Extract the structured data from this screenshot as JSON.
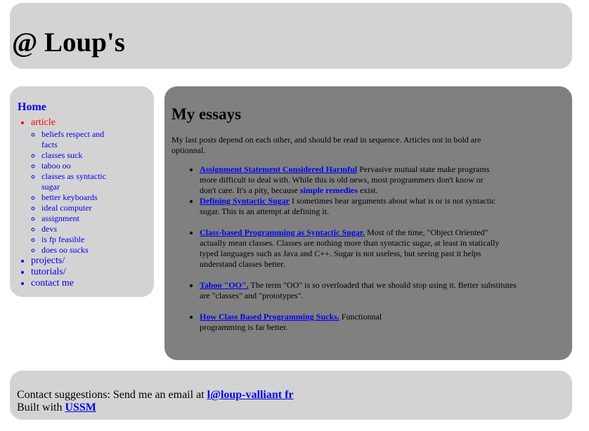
{
  "header": {
    "title": "@ Loup's"
  },
  "nav": {
    "home": "Home",
    "items": [
      {
        "label": "article",
        "current": true,
        "children": [
          "beliefs respect and facts",
          "classes suck",
          "taboo oo",
          "classes as syntactic sugar",
          "better keyboards",
          "ideal computer",
          "assignment",
          "devs",
          "is fp feasible",
          "does oo sucks"
        ]
      },
      {
        "label": "projects/"
      },
      {
        "label": "tutorials/"
      },
      {
        "label": "contact me"
      }
    ]
  },
  "main": {
    "heading": "My essays",
    "intro": "My last posts depend on each other, and should be read in sequence. Articles not in bold are optionnal.",
    "essays": [
      {
        "title": "Assignment Statement Considered Harmful",
        "text_before": " Pervasive mutual state make programs more difficult to deal with. While this is old news, most programmers don't know or don't care. It's a pity, because ",
        "inline_link": "simple remedies",
        "text_after": " exist."
      },
      {
        "title": "Defining Syntactic Sugar",
        "text": " I sometimes hear arguments about what is or is not syntactic sugar. This is an attempt at defining it."
      },
      {
        "title": "Class-based Programming as Syntactic Sugar.",
        "text": " Most of the time, \"Object Oriented\" actually mean classes. Classes are nothing more than syntactic sugar, at least in statically typed languages such as Java and C++. Sugar is not useless, but seeing past it helps understand classes better."
      },
      {
        "title": "Taboo \"OO\".",
        "text": " The term \"OO\" is so overloaded that we should stop using it. Better substitutes are \"classes\" and \"prototypes\"."
      },
      {
        "title": "How Class Based Programming Sucks.",
        "text": " Functionnal programming is far better."
      }
    ]
  },
  "footer": {
    "contact_prefix": "Contact suggestions: Send me an email at ",
    "email": "l@loup-valliant fr",
    "built_prefix": "Built with ",
    "built_link": "USSM"
  },
  "colors": {
    "panel_light": "#d3d3d3",
    "panel_dark": "#808080",
    "link": "#0000ee",
    "current": "#ff0000"
  }
}
